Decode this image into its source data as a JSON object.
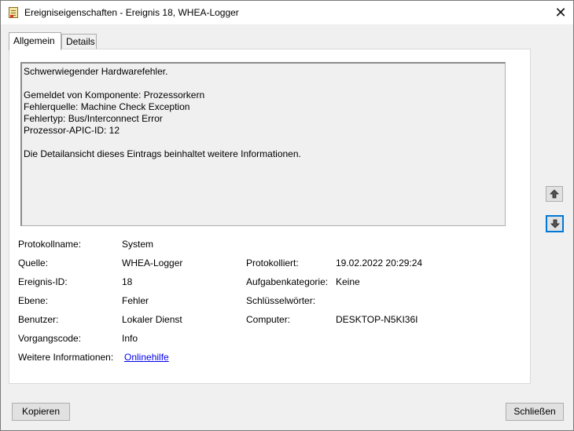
{
  "window": {
    "title": "Ereigniseigenschaften - Ereignis 18, WHEA-Logger"
  },
  "tabs": [
    {
      "label": "Allgemein",
      "active": true
    },
    {
      "label": "Details",
      "active": false
    }
  ],
  "description": {
    "line1": "Schwerwiegender Hardwarefehler.",
    "line2": "Gemeldet von Komponente: Prozessorkern",
    "line3": "Fehlerquelle: Machine Check Exception",
    "line4": "Fehlertyp: Bus/Interconnect Error",
    "line5": "Prozessor-APIC-ID: 12",
    "line6": "Die Detailansicht dieses Eintrags beinhaltet weitere Informationen."
  },
  "fields": {
    "log_name": {
      "label": "Protokollname:",
      "value": "System"
    },
    "source": {
      "label": "Quelle:",
      "value": "WHEA-Logger"
    },
    "logged": {
      "label": "Protokolliert:",
      "value": "19.02.2022 20:29:24"
    },
    "event_id": {
      "label": "Ereignis-ID:",
      "value": "18"
    },
    "task_category": {
      "label": "Aufgabenkategorie:",
      "value": "Keine"
    },
    "level": {
      "label": "Ebene:",
      "value": "Fehler"
    },
    "keywords": {
      "label": "Schlüsselwörter:",
      "value": ""
    },
    "user": {
      "label": "Benutzer:",
      "value": "Lokaler Dienst"
    },
    "computer": {
      "label": "Computer:",
      "value": "DESKTOP-N5KI36I"
    },
    "opcode": {
      "label": "Vorgangscode:",
      "value": "Info"
    },
    "more_info": {
      "label": "Weitere Informationen:",
      "link": "Onlinehilfe"
    }
  },
  "buttons": {
    "copy": "Kopieren",
    "close": "Schließen"
  },
  "icons": {
    "close": "close-icon",
    "up": "arrow-up-icon",
    "down": "arrow-down-icon"
  }
}
